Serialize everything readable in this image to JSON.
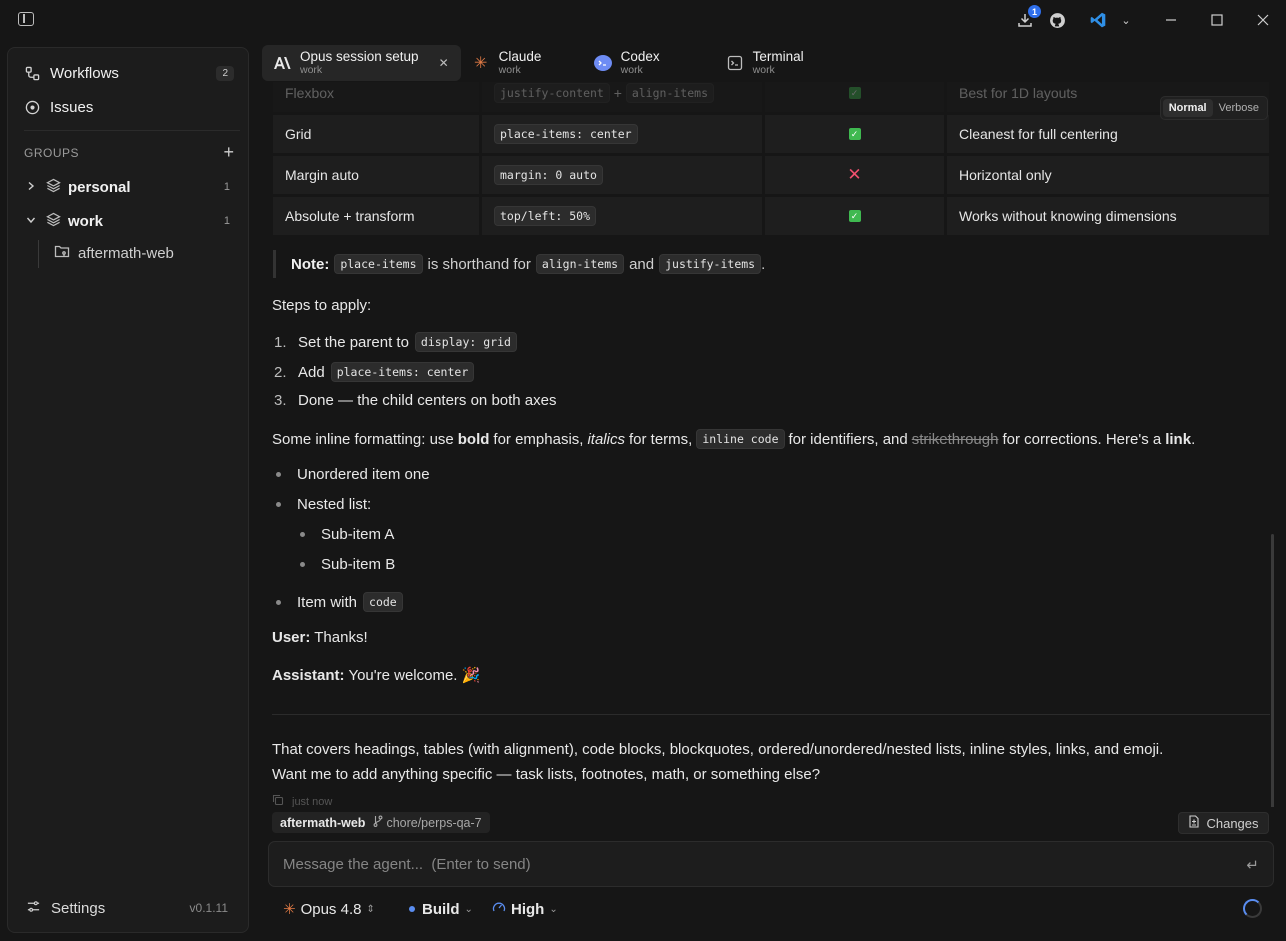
{
  "titlebar": {
    "downloads_badge": "1",
    "icons": [
      "sidebar-toggle-icon",
      "download-icon",
      "github-icon",
      "vscode-icon",
      "chevron-down-icon"
    ]
  },
  "sidebar": {
    "nav": [
      {
        "label": "Workflows",
        "count": "2"
      },
      {
        "label": "Issues"
      }
    ],
    "groups_label": "GROUPS",
    "groups": [
      {
        "label": "personal",
        "count": "1",
        "expanded": false
      },
      {
        "label": "work",
        "count": "1",
        "expanded": true
      }
    ],
    "child": "aftermath-web",
    "settings_label": "Settings",
    "version": "v0.1.11"
  },
  "tabs": [
    {
      "title": "Opus session setup",
      "sub": "work",
      "active": true
    },
    {
      "title": "Claude",
      "sub": "work"
    },
    {
      "title": "Codex",
      "sub": "work"
    },
    {
      "title": "Terminal",
      "sub": "work"
    }
  ],
  "mode": {
    "normal": "Normal",
    "verbose": "Verbose",
    "selected": "Normal"
  },
  "table": {
    "rows": [
      {
        "method": "Flexbox",
        "code1": "justify-content",
        "plus": "+",
        "code2": "align-items",
        "works": "check",
        "note": "Best for 1D layouts"
      },
      {
        "method": "Grid",
        "code1": "place-items: center",
        "works": "check",
        "note": "Cleanest for full centering"
      },
      {
        "method": "Margin auto",
        "code1": "margin: 0 auto",
        "works": "cross",
        "note": "Horizontal only"
      },
      {
        "method": "Absolute + transform",
        "code1": "top/left: 50%",
        "works": "check",
        "note": "Works without knowing dimensions"
      }
    ]
  },
  "note": {
    "label": "Note:",
    "code_a": "place-items",
    "text_a": "is shorthand for",
    "code_b": "align-items",
    "text_b": "and",
    "code_c": "justify-items",
    "end": "."
  },
  "steps": {
    "heading": "Steps to apply:",
    "items": [
      {
        "n": "1.",
        "text": "Set the parent to",
        "code": "display: grid"
      },
      {
        "n": "2.",
        "text": "Add",
        "code": "place-items: center"
      },
      {
        "n": "3.",
        "text": "Done — the child centers on both axes"
      }
    ]
  },
  "inline": {
    "t1": "Some inline formatting: use",
    "bold": "bold",
    "t2": "for emphasis,",
    "italics": "italics",
    "t3": "for terms,",
    "code": "inline code",
    "t4": "for identifiers, and",
    "strike": "strikethrough",
    "t5": "for corrections. Here's a",
    "link": "link",
    "end": "."
  },
  "ul": {
    "item1": "Unordered item one",
    "item2": "Nested list:",
    "sub_a": "Sub-item A",
    "sub_b": "Sub-item B",
    "item3": "Item with",
    "item3_code": "code"
  },
  "dialog": {
    "user_label": "User:",
    "user_text": "Thanks!",
    "assistant_label": "Assistant:",
    "assistant_text": "You're welcome. 🎉"
  },
  "summary": {
    "line1": "That covers headings, tables (with alignment), code blocks, blockquotes, ordered/unordered/nested lists, inline styles, links, and emoji.",
    "line2": "Want me to add anything specific — task lists, footnotes, math, or something else?",
    "timestamp": "just now"
  },
  "footer": {
    "repo": "aftermath-web",
    "branch": "chore/perps-qa-7",
    "changes_label": "Changes",
    "input_placeholder": "Message the agent...  (Enter to send)",
    "model": "Opus 4.8",
    "mode": "Build",
    "effort": "High"
  }
}
